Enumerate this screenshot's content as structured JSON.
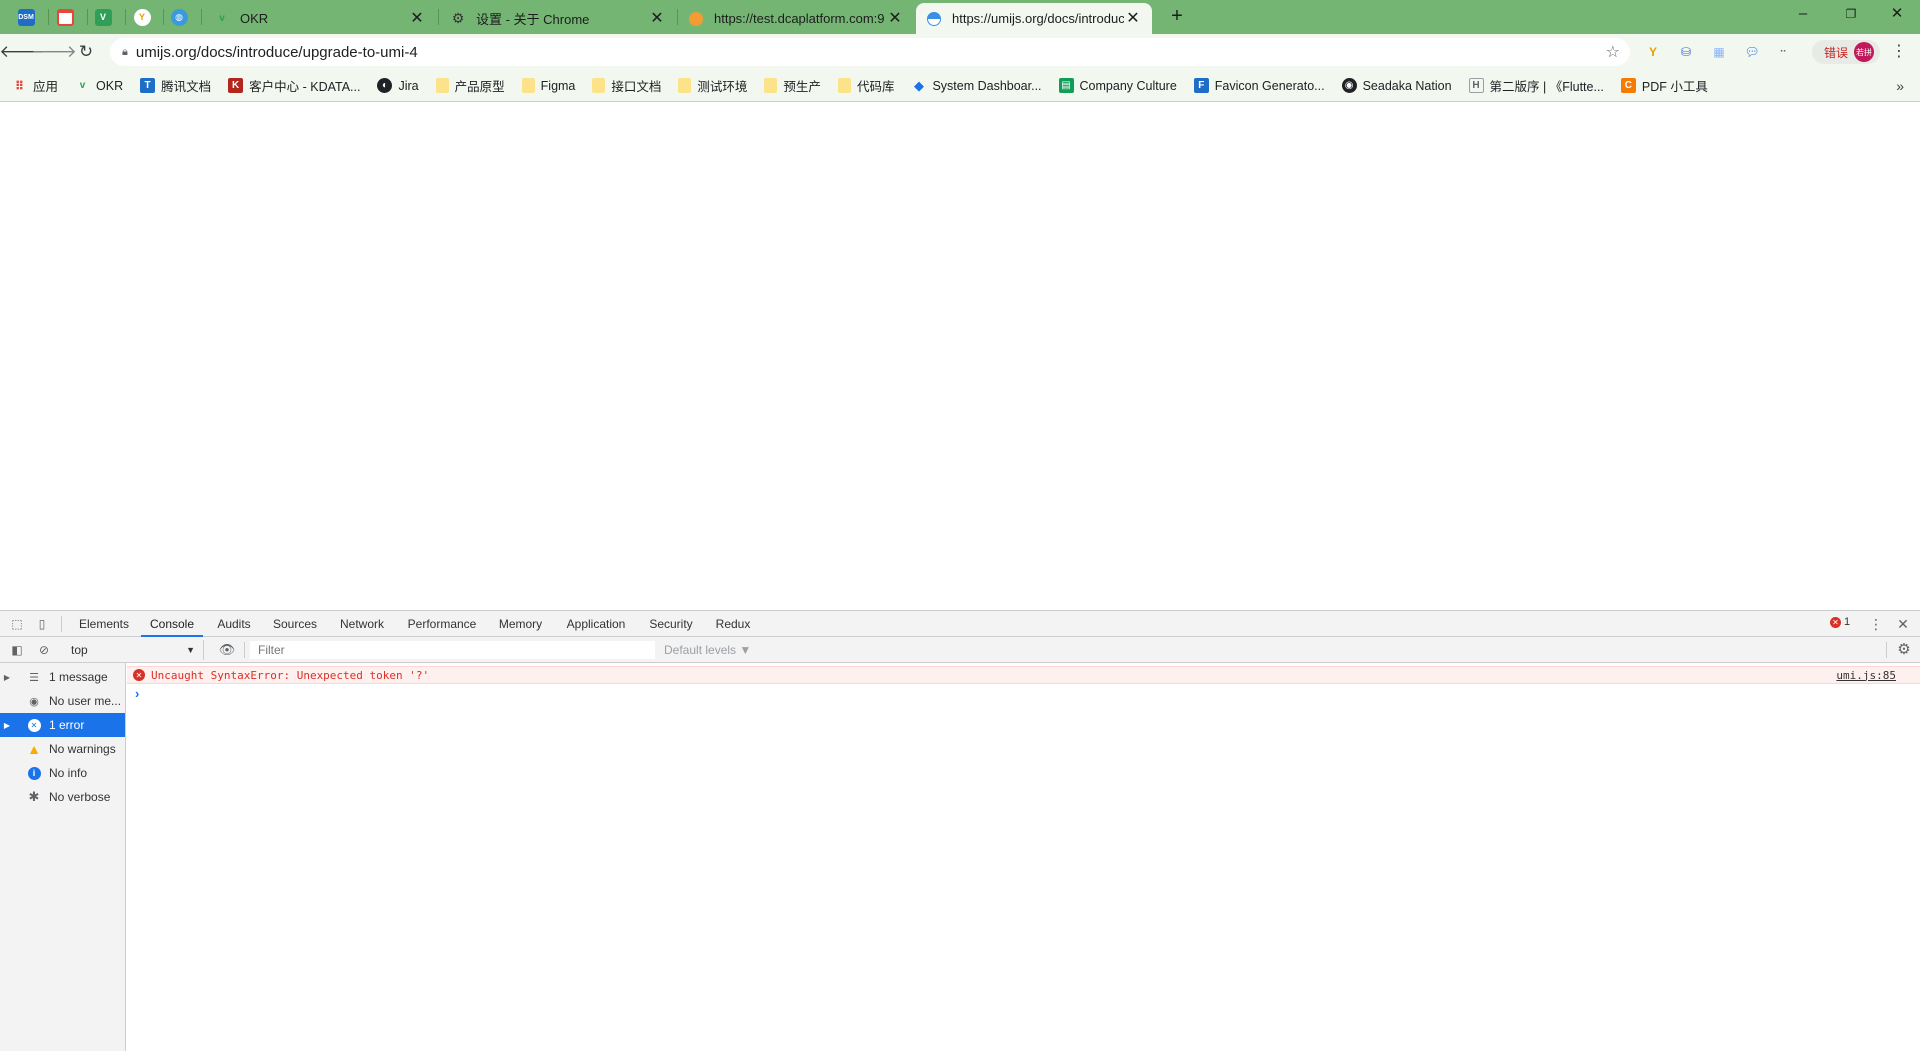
{
  "browser": {
    "pinned_tabs": [
      {
        "icon": "dsm-icon",
        "text": "DSM",
        "color": "#1e6ec8"
      },
      {
        "icon": "calendar-icon",
        "text": "",
        "color": "#e8453c"
      },
      {
        "icon": "v-icon",
        "text": "V",
        "color": "#2f9e57"
      },
      {
        "icon": "yuque-icon",
        "text": "Y",
        "color": "#ffffff"
      },
      {
        "icon": "globe-icon",
        "text": "",
        "color": "#3a9ae0"
      }
    ],
    "tabs": [
      {
        "title": "OKR",
        "favicon": "okr-icon"
      },
      {
        "title": "设置 - 关于 Chrome",
        "favicon": "gear-icon"
      },
      {
        "title": "https://test.dcaplatform.com:9",
        "favicon": "dcaplatform-icon"
      },
      {
        "title": "https://umijs.org/docs/introduce",
        "favicon": "umi-icon",
        "active": true
      }
    ],
    "window_controls": [
      "–",
      "❐",
      "✕"
    ],
    "accent": "#74b573",
    "toolbar_bg": "#f2f7ef"
  },
  "toolbar": {
    "url": "umijs.org/docs/introduce/upgrade-to-umi-4",
    "profile_label": "错误",
    "avatar_text": "若拼"
  },
  "bookmarks": [
    {
      "label": "应用",
      "icon": "apps-icon"
    },
    {
      "label": "OKR",
      "icon": "okr-icon"
    },
    {
      "label": "腾讯文档",
      "icon": "tencent-docs-icon"
    },
    {
      "label": "客户中心 - KDATA...",
      "icon": "kdata-icon"
    },
    {
      "label": "Jira",
      "icon": "jira-icon"
    },
    {
      "label": "产品原型",
      "icon": "folder-icon"
    },
    {
      "label": "Figma",
      "icon": "folder-icon"
    },
    {
      "label": "接口文档",
      "icon": "folder-icon"
    },
    {
      "label": "测试环境",
      "icon": "folder-icon"
    },
    {
      "label": "预生产",
      "icon": "folder-icon"
    },
    {
      "label": "代码库",
      "icon": "folder-icon"
    },
    {
      "label": "System Dashboar...",
      "icon": "system-dashboard-icon"
    },
    {
      "label": "Company Culture",
      "icon": "sheets-icon"
    },
    {
      "label": "Favicon Generato...",
      "icon": "favicon-generator-icon"
    },
    {
      "label": "Seadaka Nation",
      "icon": "seadaka-icon"
    },
    {
      "label": "第二版序 | 《Flutte...",
      "icon": "flutter-book-icon"
    },
    {
      "label": "PDF 小工具",
      "icon": "pdf-tool-icon"
    }
  ],
  "devtools": {
    "tabs": [
      "Elements",
      "Console",
      "Audits",
      "Sources",
      "Network",
      "Performance",
      "Memory",
      "Application",
      "Security",
      "Redux"
    ],
    "active_tab": "Console",
    "error_count": "1",
    "context": "top",
    "filter_placeholder": "Filter",
    "levels": "Default levels ▼",
    "sidebar": [
      {
        "label": "1 message",
        "icon": "list-icon",
        "expandable": true
      },
      {
        "label": "No user me...",
        "icon": "user-icon"
      },
      {
        "label": "1 error",
        "icon": "error-icon",
        "expandable": true,
        "selected": true
      },
      {
        "label": "No warnings",
        "icon": "warning-icon"
      },
      {
        "label": "No info",
        "icon": "info-icon"
      },
      {
        "label": "No verbose",
        "icon": "bug-icon"
      }
    ],
    "messages": [
      {
        "level": "error",
        "text": "Uncaught SyntaxError: Unexpected token '?'",
        "source": "umi.js:85"
      }
    ],
    "prompt": "›"
  }
}
